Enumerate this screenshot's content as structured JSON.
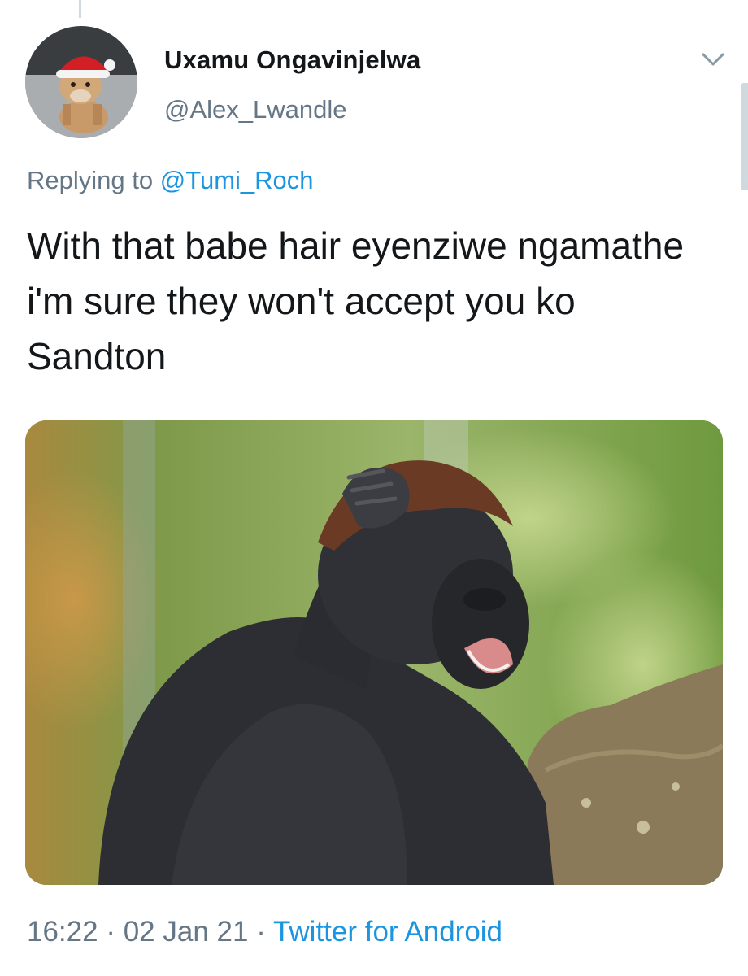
{
  "tweet": {
    "author": {
      "display_name": "Uxamu Ongavinjelwa",
      "handle": "@Alex_Lwandle",
      "avatar_icon": "puppy-santa-hat-avatar"
    },
    "menu_icon": "chevron-down-icon",
    "reply": {
      "prefix": "Replying to",
      "mention": "@Tumi_Roch"
    },
    "text": "With that babe hair eyenziwe ngamathe i'm sure they won't accept you ko Sandton",
    "media": {
      "subject": "gorilla-scratching-head-photo"
    },
    "meta": {
      "time": "16:22",
      "separator": "·",
      "date": "02 Jan 21",
      "source": "Twitter for Android"
    }
  },
  "colors": {
    "primary_text": "#14171a",
    "secondary_text": "#657786",
    "link": "#1b95e0",
    "divider": "#cfd9de"
  }
}
